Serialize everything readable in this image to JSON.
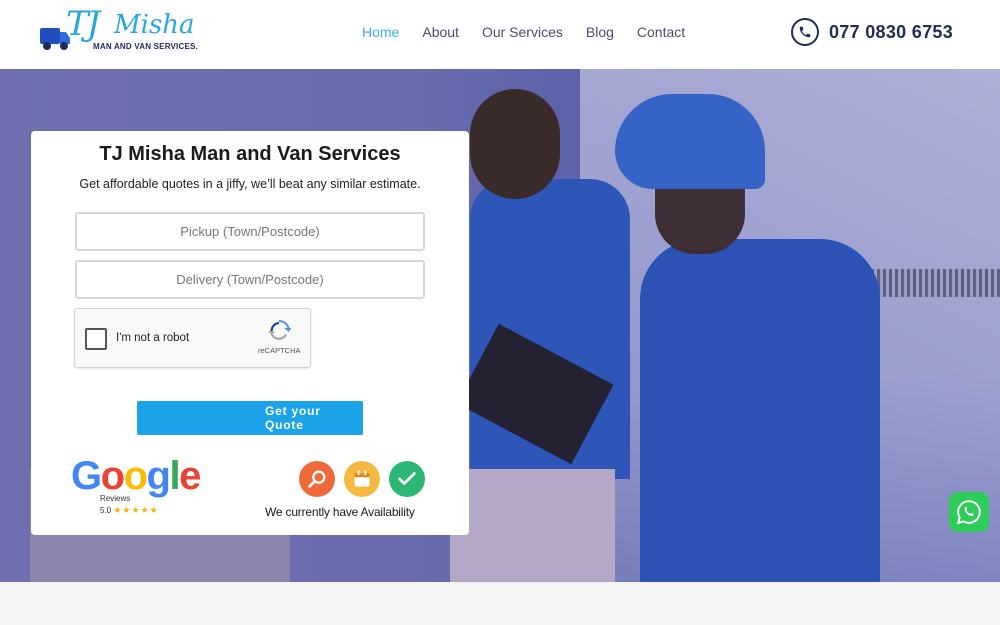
{
  "brand": {
    "logo_tj": "TJ",
    "logo_misha": "Misha",
    "logo_sub": "MAN AND VAN SERVICES."
  },
  "nav": {
    "items": [
      "Home",
      "About",
      "Our Services",
      "Blog",
      "Contact"
    ],
    "active": "Home"
  },
  "header": {
    "phone": "077 0830 6753"
  },
  "quote_form": {
    "title": "TJ Misha Man and Van Services",
    "subtitle": "Get affordable quotes in a jiffy, we’ll beat any similar estimate.",
    "pickup_placeholder": "Pickup (Town/Postcode)",
    "delivery_placeholder": "Delivery (Town/Postcode)",
    "captcha_label": "I'm not a robot",
    "captcha_brand": "reCAPTCHA",
    "submit_label": "Get your Quote"
  },
  "badges": {
    "google_word": "Google",
    "google_reviews": "Reviews",
    "google_rating": "5.0",
    "google_stars": "★★★★★",
    "availability": "We currently have Availability"
  },
  "colors": {
    "accent": "#1aa3e8",
    "navy": "#232b59",
    "nav_active": "#36b0e0",
    "whatsapp": "#2ecc59"
  }
}
